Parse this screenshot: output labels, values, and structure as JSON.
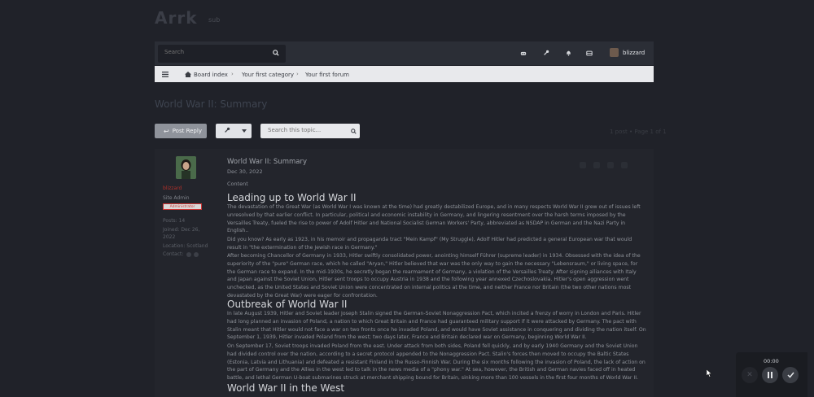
{
  "brand": {
    "title": "Arrk",
    "subtitle": "sub"
  },
  "search": {
    "placeholder": "Search"
  },
  "user": {
    "name": "blizzard"
  },
  "breadcrumb": [
    "Board index",
    "Your first category",
    "Your first forum"
  ],
  "topic": {
    "title": "World War II: Summary",
    "reply_label": "Post Reply",
    "search_placeholder": "Search this topic...",
    "post_count": "1 post • Page 1 of 1"
  },
  "author": {
    "name": "blizzard",
    "rank": "Site Admin",
    "badge": "Administrator",
    "posts": "Posts: 14",
    "joined": "Joined: Dec 26,",
    "joined2": "2022",
    "location": "Location: Scotland",
    "contact": "Contact:"
  },
  "post": {
    "subject": "World War II: Summary",
    "date": "Dec 30, 2022",
    "content_label": "Content",
    "h1": "Leading up to World War II",
    "p1": "The devastation of the Great War (as World War I was known at the time) had greatly destabilized Europe, and in many respects World War II grew out of issues left unresolved by that earlier conflict. In particular, political and economic instability in Germany, and lingering resentment over the harsh terms imposed by the Versailles Treaty, fueled the rise to power of Adolf Hitler and National Socialist German Workers' Party, abbreviated as NSDAP in German and the Nazi Party in English..",
    "p2": "Did you know? As early as 1923, in his memoir and propaganda tract \"Mein Kampf\" (My Struggle), Adolf Hitler had predicted a general European war that would result in \"the extermination of the Jewish race in Germany.\"",
    "p3": "After becoming Chancellor of Germany in 1933, Hitler swiftly consolidated power, anointing himself Führer (supreme leader) in 1934. Obsessed with the idea of the superiority of the \"pure\" German race, which he called \"Aryan,\" Hitler believed that war was the only way to gain the necessary \"Lebensraum,\" or living space, for the German race to expand. In the mid-1930s, he secretly began the rearmament of Germany, a violation of the Versailles Treaty. After signing alliances with Italy and Japan against the Soviet Union, Hitler sent troops to occupy Austria in 1938 and the following year annexed Czechoslovakia. Hitler's open aggression went unchecked, as the United States and Soviet Union were concentrated on internal politics at the time, and neither France nor Britain (the two other nations most devastated by the Great War) were eager for confrontation.",
    "h2": "Outbreak of World War II",
    "p4": "In late August 1939, Hitler and Soviet leader Joseph Stalin signed the German-Soviet Nonaggression Pact, which incited a frenzy of worry in London and Paris. Hitler had long planned an invasion of Poland, a nation to which Great Britain and France had guaranteed military support if it were attacked by Germany. The pact with Stalin meant that Hitler would not face a war on two fronts once he invaded Poland, and would have Soviet assistance in conquering and dividing the nation itself. On September 1, 1939, Hitler invaded Poland from the west; two days later, France and Britain declared war on Germany, beginning World War II.",
    "p5": "On September 17, Soviet troops invaded Poland from the east. Under attack from both sides, Poland fell quickly, and by early 1940 Germany and the Soviet Union had divided control over the nation, according to a secret protocol appended to the Nonaggression Pact. Stalin's forces then moved to occupy the Baltic States (Estonia, Latvia and Lithuania) and defeated a resistant Finland in the Russo-Finnish War. During the six months following the invasion of Poland, the lack of action on the part of Germany and the Allies in the west led to talk in the news media of a \"phony war.\" At sea, however, the British and German navies faced off in heated battle, and lethal German U-boat submarines struck at merchant shipping bound for Britain, sinking more than 100 vessels in the first four months of World War II.",
    "h3": "World War II in the West"
  },
  "player": {
    "time": "00:00"
  }
}
